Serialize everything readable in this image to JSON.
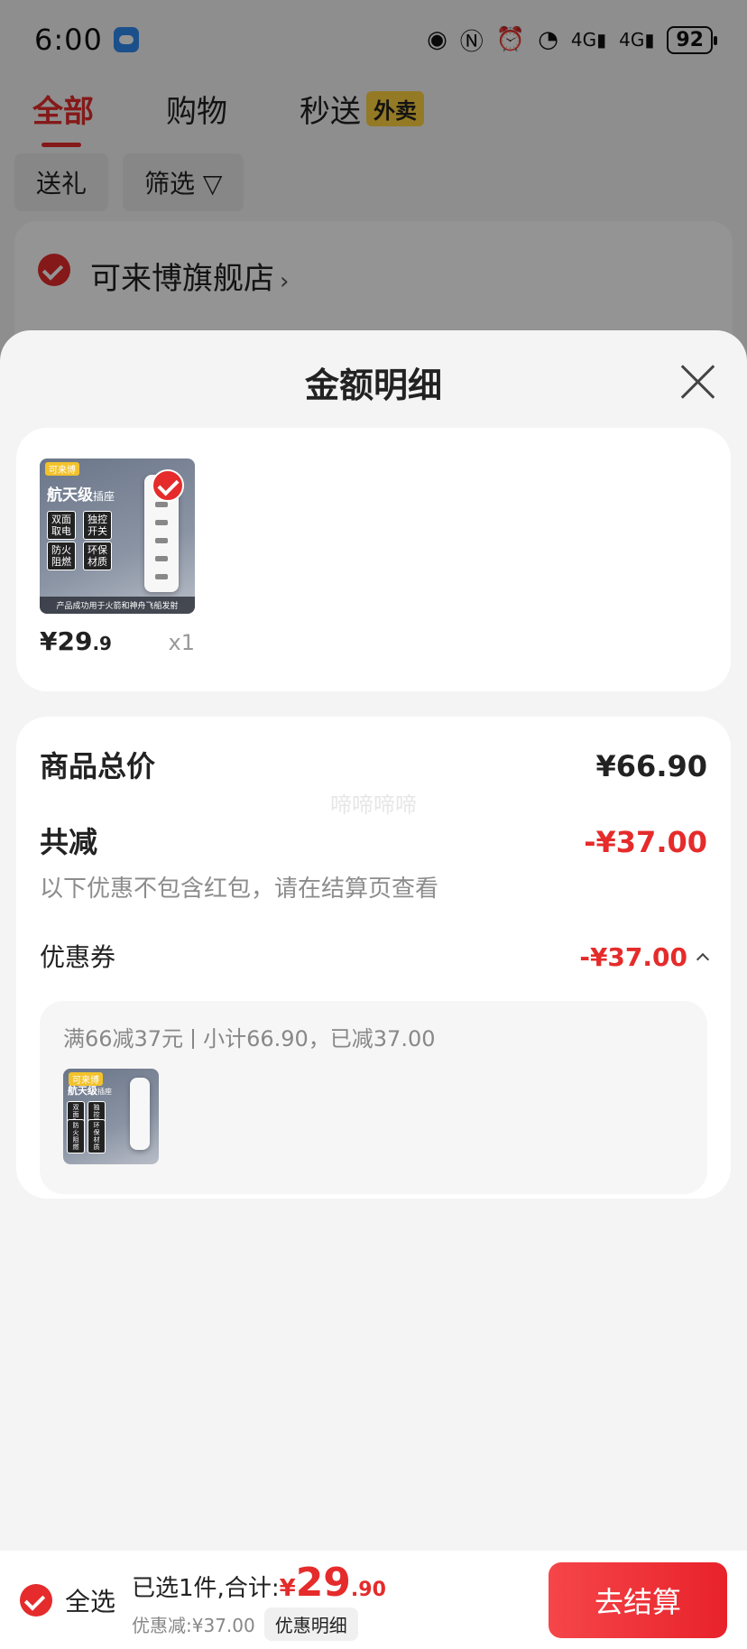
{
  "status_bar": {
    "time": "6:00",
    "battery": "92",
    "net1": "4G",
    "net2": "4G"
  },
  "tabs": [
    {
      "label": "全部"
    },
    {
      "label": "购物"
    },
    {
      "label": "秒送",
      "badge": "外卖"
    }
  ],
  "filters": {
    "gift": "送礼",
    "filter": "筛选 ▽"
  },
  "store": {
    "name": "可来博旗舰店",
    "arrow": "›"
  },
  "sheet": {
    "title": "金额明细"
  },
  "product": {
    "brand": "可来博",
    "headline": "航天级",
    "headline_suffix": "插座",
    "features": [
      "双面取电",
      "独控开关",
      "防火阻燃",
      "环保材质"
    ],
    "caption": "产品成功用于火箭和神舟飞船发射",
    "price_int": "¥29",
    "price_dec": ".9",
    "qty": "x1"
  },
  "summary": {
    "total_label": "商品总价",
    "total_value": "¥66.90",
    "watermark": "啼啼啼啼",
    "discount_label": "共减",
    "discount_value": "-¥37.00",
    "discount_note": "以下优惠不包含红包，请在结算页查看",
    "coupon_label": "优惠券",
    "coupon_value": "-¥37.00",
    "coupon_rule": "满66减37元",
    "coupon_detail": "小计66.90，已减37.00"
  },
  "bottom_bar": {
    "select_all": "全选",
    "selected_text": "已选1件,合计:",
    "total_cur": "¥",
    "total_int": "29",
    "total_dec": ".90",
    "discount_text": "优惠减:¥37.00",
    "detail_chip": "优惠明细",
    "checkout": "去结算"
  },
  "colors": {
    "accent": "#e52b2b",
    "badge": "#ffd23f"
  }
}
